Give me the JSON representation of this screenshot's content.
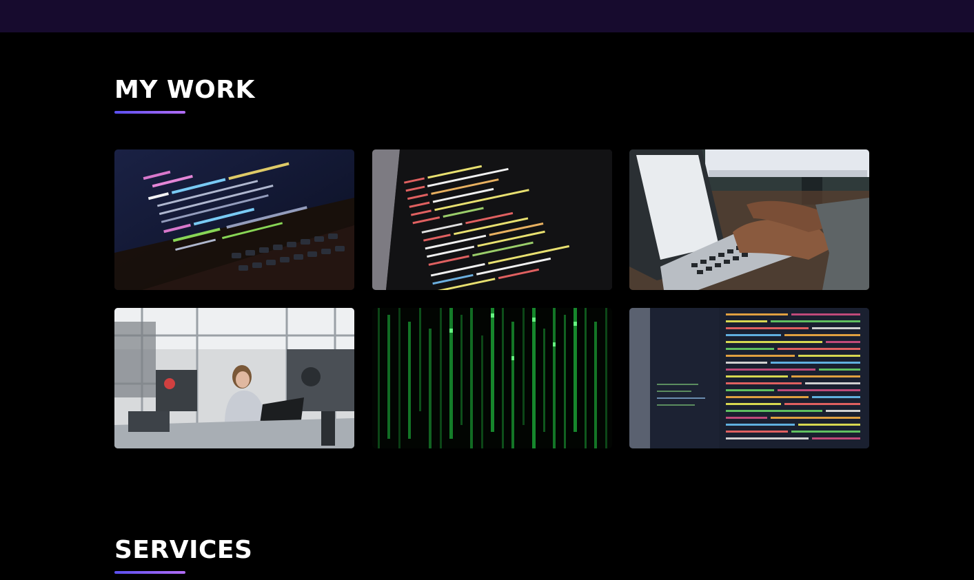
{
  "sections": {
    "work": {
      "title": "MY WORK"
    },
    "services": {
      "title": "SERVICES"
    }
  },
  "work_items": [
    {
      "image": "code-on-laptop-screen"
    },
    {
      "image": "html-code-on-monitor"
    },
    {
      "image": "hands-typing-on-laptop"
    },
    {
      "image": "engineer-in-hardware-lab"
    },
    {
      "image": "green-matrix-code-rain"
    },
    {
      "image": "colorful-code-on-monitor"
    }
  ],
  "colors": {
    "topbar": "#170b2e",
    "background": "#000000",
    "underline_start": "#5a4ff0",
    "underline_end": "#b26df5"
  }
}
